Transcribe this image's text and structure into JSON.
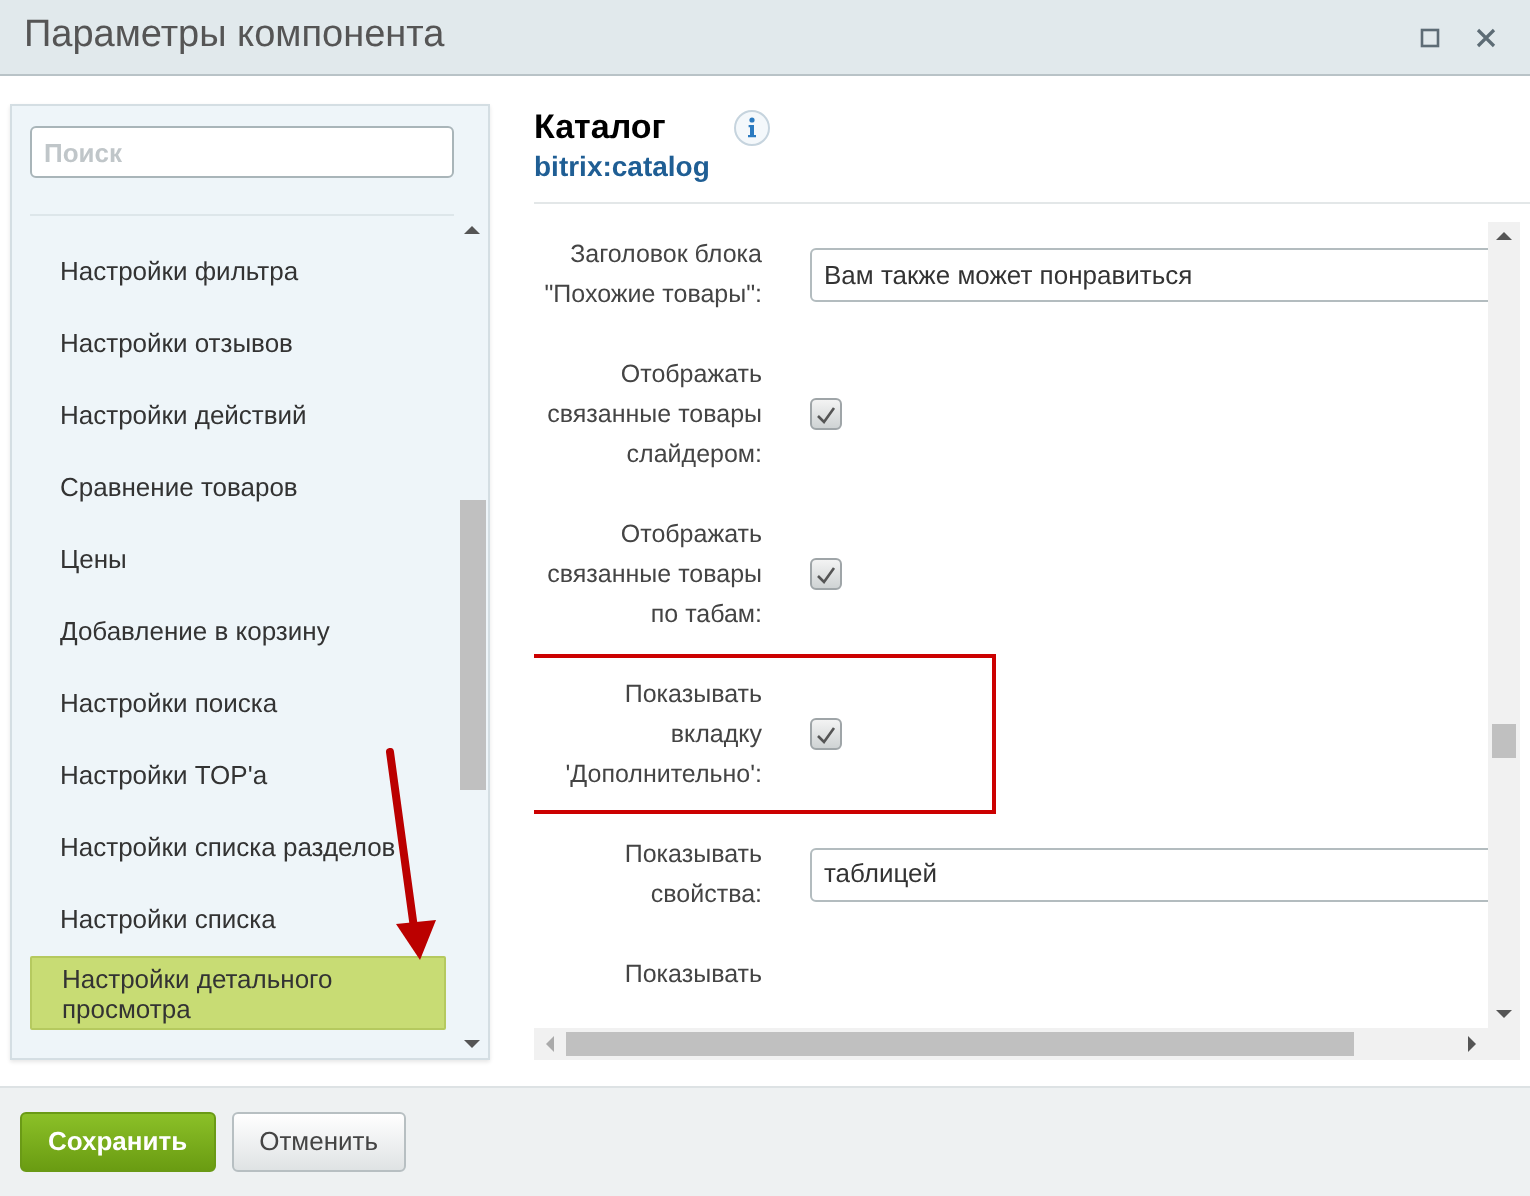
{
  "window": {
    "title": "Параметры компонента"
  },
  "search": {
    "placeholder": "Поиск"
  },
  "sections": [
    {
      "label": "Настройки фильтра",
      "selected": false
    },
    {
      "label": "Настройки отзывов",
      "selected": false
    },
    {
      "label": "Настройки действий",
      "selected": false
    },
    {
      "label": "Сравнение товаров",
      "selected": false
    },
    {
      "label": "Цены",
      "selected": false
    },
    {
      "label": "Добавление в корзину",
      "selected": false
    },
    {
      "label": "Настройки поиска",
      "selected": false
    },
    {
      "label": "Настройки TOP'а",
      "selected": false
    },
    {
      "label": "Настройки списка разделов",
      "selected": false
    },
    {
      "label": "Настройки списка",
      "selected": false
    },
    {
      "label": "Настройки детального просмотра",
      "selected": true
    }
  ],
  "component": {
    "title": "Каталог",
    "code": "bitrix:catalog"
  },
  "fields": [
    {
      "kind": "text",
      "label": "Заголовок блока \"Похожие товары\":",
      "value": "Вам также может понравиться",
      "highlighted": false
    },
    {
      "kind": "checkbox",
      "label": "Отображать связанные товары слайдером:",
      "checked": true,
      "highlighted": false
    },
    {
      "kind": "checkbox",
      "label": "Отображать связанные товары по табам:",
      "checked": true,
      "highlighted": false
    },
    {
      "kind": "checkbox",
      "label": "Показывать вкладку 'Дополнительно':",
      "checked": true,
      "highlighted": true
    },
    {
      "kind": "select",
      "label": "Показывать свойства:",
      "value": "таблицей",
      "highlighted": false
    },
    {
      "kind": "none",
      "label": "Показывать",
      "highlighted": false
    }
  ],
  "buttons": [
    {
      "label": "Сохранить",
      "kind": "primary"
    },
    {
      "label": "Отменить",
      "kind": "secondary"
    }
  ]
}
